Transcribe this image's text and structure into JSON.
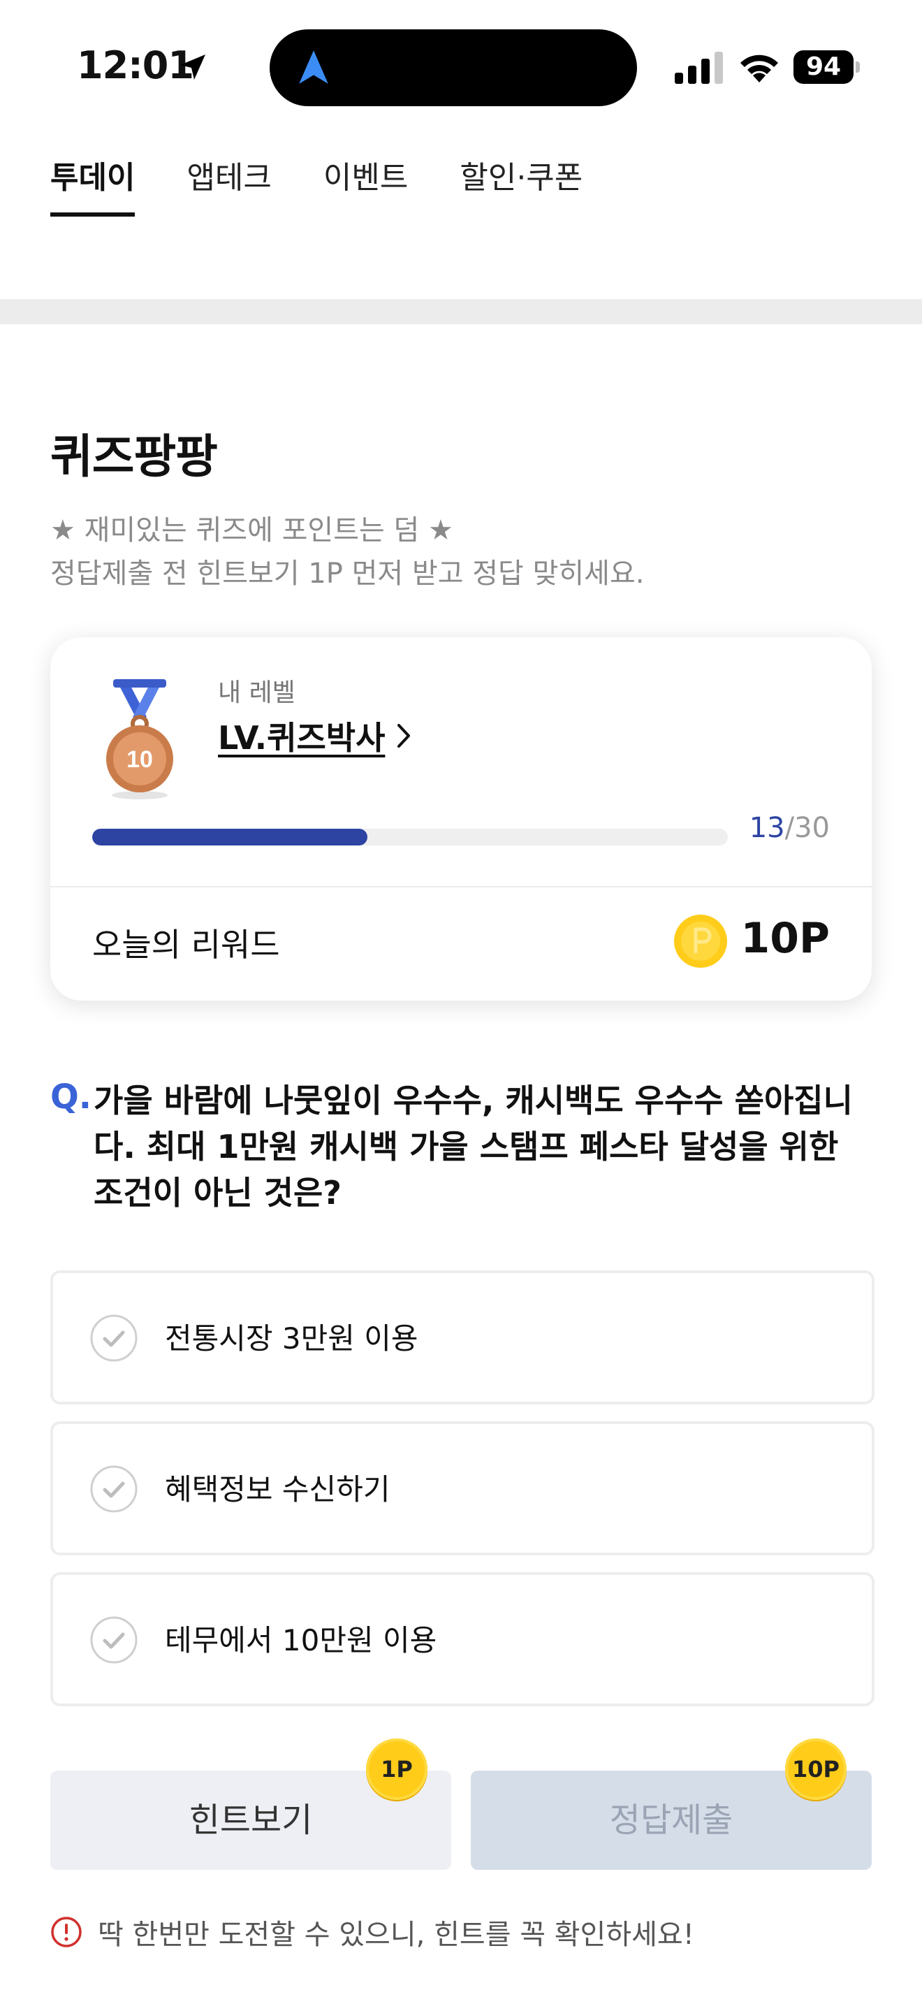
{
  "status_bar": {
    "time": "12:01",
    "battery": "94"
  },
  "tabs": [
    {
      "label": "투데이",
      "active": true
    },
    {
      "label": "앱테크",
      "active": false
    },
    {
      "label": "이벤트",
      "active": false
    },
    {
      "label": "할인·쿠폰",
      "active": false
    }
  ],
  "quiz": {
    "title": "퀴즈팡팡",
    "desc_line1": "★ 재미있는 퀴즈에 포인트는 덤 ★",
    "desc_line2": "정답제출 전 힌트보기 1P 먼저 받고 정답 맞히세요."
  },
  "level_card": {
    "medal_number": "10",
    "my_level_label": "내 레벨",
    "level_name": "LV.퀴즈박사",
    "progress_current": "13",
    "progress_total": "/30",
    "progress_fraction": 0.433,
    "reward_label": "오늘의 리워드",
    "reward_value": "10P"
  },
  "question": {
    "mark": "Q.",
    "text": "가을 바람에 나뭇잎이 우수수, 캐시백도 우수수 쏟아집니다. 최대 1만원 캐시백 가을 스탬프 페스타 달성을 위한 조건이 아닌 것은?"
  },
  "options": [
    {
      "label": "전통시장 3만원 이용"
    },
    {
      "label": "혜택정보 수신하기"
    },
    {
      "label": "테무에서 10만원 이용"
    }
  ],
  "buttons": {
    "hint_label": "힌트보기",
    "hint_badge": "1P",
    "submit_label": "정답제출",
    "submit_badge": "10P"
  },
  "warning": "딱 한번만 도전할 수 있으니, 힌트를 꼭 확인하세요!",
  "colors": {
    "accent": "#2d44a3",
    "question_mark": "#3a63d8",
    "coin": "#ffcc1a",
    "warning": "#d0312d"
  },
  "icons": [
    "location-arrow-icon",
    "navigation-icon",
    "signal-icon",
    "wifi-icon",
    "battery-icon",
    "medal-icon",
    "chevron-right-icon",
    "coin-icon",
    "check-circle-icon",
    "alert-circle-icon"
  ]
}
